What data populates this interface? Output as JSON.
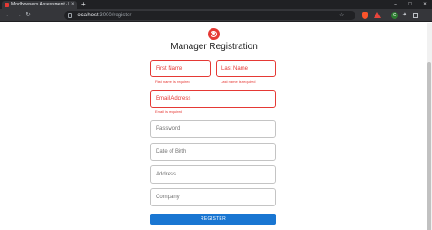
{
  "browser": {
    "tab_title": "Mindbowser's Assessment - Emp...",
    "tab_close": "×",
    "new_tab": "+",
    "window_controls": [
      "–",
      "□",
      "×"
    ],
    "nav": {
      "back": "←",
      "forward": "→",
      "reload": "↻"
    },
    "address": {
      "host": "localhost",
      "path": ":3000/register"
    },
    "bookmark": "☆",
    "ext_g_label": "G",
    "puzzle": "✦",
    "menu": "⋮"
  },
  "page": {
    "title": "Manager Registration",
    "icon": "account-circle-icon",
    "accent_color": "#e53935",
    "primary_color": "#1976d2",
    "fields": {
      "first_name": {
        "label": "First Name",
        "value": "",
        "error": "First name is required"
      },
      "last_name": {
        "label": "Last Name",
        "value": "",
        "error": "Last name is required"
      },
      "email": {
        "label": "Email Address",
        "value": "",
        "error": "Email is required"
      },
      "password": {
        "label": "Password",
        "value": ""
      },
      "dob": {
        "label": "Date of Birth",
        "value": ""
      },
      "address": {
        "label": "Address",
        "value": ""
      },
      "company": {
        "label": "Company",
        "value": ""
      }
    },
    "register_label": "REGISTER"
  }
}
